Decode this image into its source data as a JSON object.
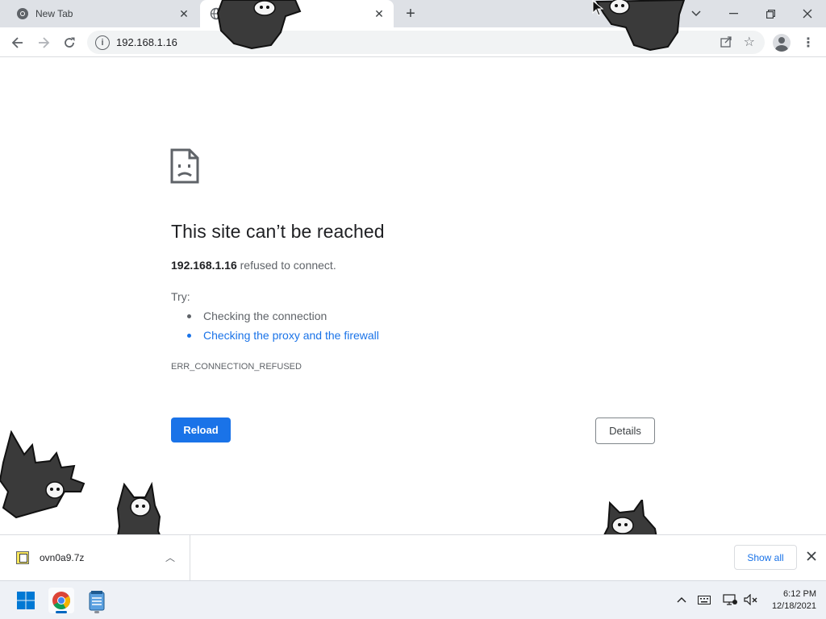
{
  "tabs": [
    {
      "title": "New Tab",
      "icon": "chrome-icon"
    },
    {
      "title": "",
      "icon": "globe-icon"
    }
  ],
  "toolbar": {
    "url": "192.168.1.16"
  },
  "error": {
    "title": "This site can’t be reached",
    "host": "192.168.1.16",
    "message": " refused to connect.",
    "try_label": "Try:",
    "suggestions": [
      {
        "text": "Checking the connection",
        "is_link": false
      },
      {
        "text": "Checking the proxy and the firewall",
        "is_link": true
      }
    ],
    "code": "ERR_CONNECTION_REFUSED",
    "reload_label": "Reload",
    "details_label": "Details"
  },
  "download_shelf": {
    "filename": "ovn0a9.7z",
    "show_all_label": "Show all"
  },
  "taskbar": {
    "time": "6:12 PM",
    "date": "12/18/2021"
  },
  "colors": {
    "accent": "#1a73e8",
    "tab_strip": "#dee1e6",
    "taskbar": "#eef1f6"
  }
}
